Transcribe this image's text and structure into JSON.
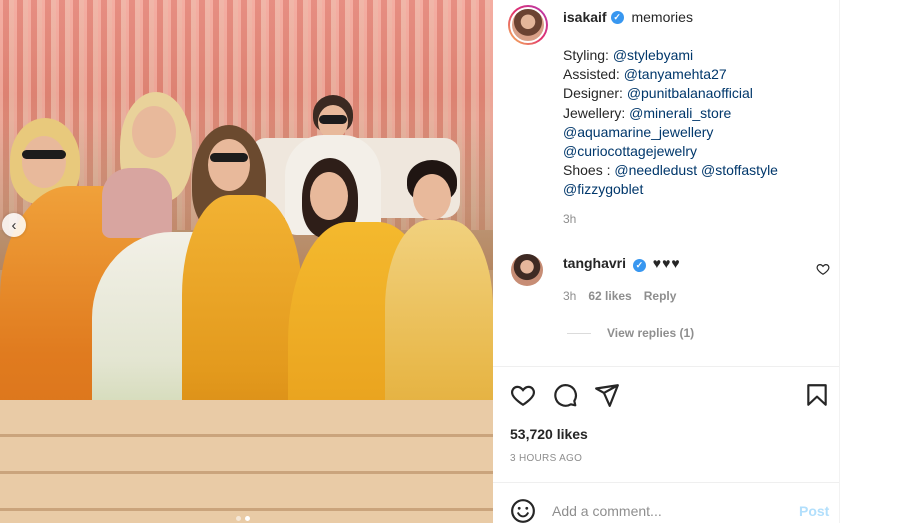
{
  "post": {
    "username": "isakaif",
    "verified": true,
    "caption_head": "⁣ memories ⁣",
    "caption_lines": [
      [
        {
          "text": "Styling: ",
          "mention": false
        },
        {
          "text": "@stylebyami",
          "mention": true
        }
      ],
      [
        {
          "text": "Assisted: ",
          "mention": false
        },
        {
          "text": "@tanyamehta27",
          "mention": true
        }
      ],
      [
        {
          "text": "Designer: ",
          "mention": false
        },
        {
          "text": "@punitbalanaofficial",
          "mention": true
        }
      ],
      [
        {
          "text": "Jewellery: ",
          "mention": false
        },
        {
          "text": "@minerali_store",
          "mention": true
        }
      ],
      [
        {
          "text": "@aquamarine_jewellery",
          "mention": true
        }
      ],
      [
        {
          "text": "@curiocottagejewelry",
          "mention": true
        }
      ],
      [
        {
          "text": "Shoes : ",
          "mention": false
        },
        {
          "text": "@needledust",
          "mention": true
        },
        {
          "text": " ",
          "mention": false
        },
        {
          "text": "@stoffastyle",
          "mention": true
        }
      ],
      [
        {
          "text": "@fizzygoblet",
          "mention": true
        }
      ]
    ],
    "caption_time": "3h"
  },
  "comment": {
    "username": "tanghavri",
    "verified": true,
    "text": "♥♥♥",
    "time": "3h",
    "likes": "62 likes",
    "reply_label": "Reply",
    "view_replies": "View replies (1)"
  },
  "actions": {
    "like_icon": "heart-icon",
    "comment_icon": "comment-icon",
    "share_icon": "paper-plane-icon",
    "save_icon": "bookmark-icon"
  },
  "stats": {
    "likes": "53,720 likes",
    "posted_ago": "3 HOURS AGO"
  },
  "composer": {
    "placeholder": "Add a comment...",
    "post_label": "Post"
  },
  "colors": {
    "accent_blue": "#3897f0",
    "mention_blue": "#00376b",
    "post_disabled": "#b2dffc"
  }
}
